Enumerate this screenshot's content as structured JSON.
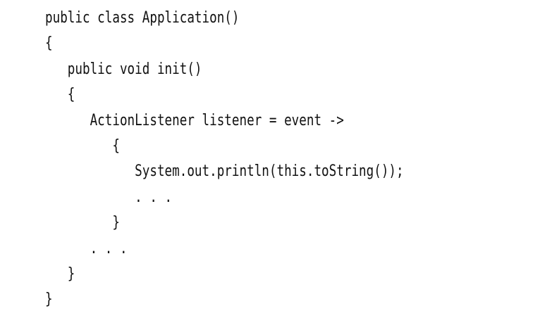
{
  "code": {
    "lines": [
      "public class Application()",
      "{",
      "   public void init()",
      "   {",
      "      ActionListener listener = event ->",
      "         {",
      "            System.out.println(this.toString());",
      "            . . .",
      "         }",
      "      . . .",
      "   }",
      "}"
    ]
  }
}
